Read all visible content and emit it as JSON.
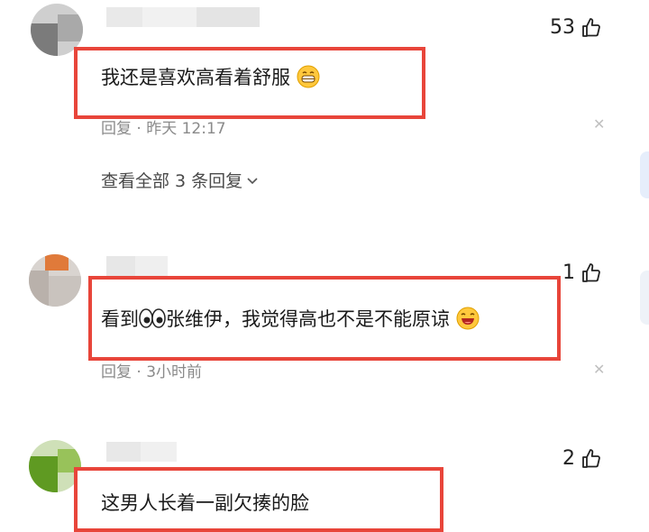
{
  "comments": [
    {
      "likes": "53",
      "text": "我还是喜欢高看着舒服",
      "emoji": "grin-emoji",
      "meta": "回复 · 昨天 12:17",
      "view_replies": "查看全部 3 条回复"
    },
    {
      "likes": "1",
      "text_before": "看到",
      "text_after": "张维伊，我觉得高也不是不能原谅",
      "emoji_inline": "eyes-emoji",
      "emoji": "laugh-emoji",
      "meta": "回复 · 3小时前"
    },
    {
      "likes": "2",
      "text": "这男人长着一副欠揍的脸"
    }
  ],
  "colors": {
    "highlight_border": "#e8453a",
    "meta_text": "#8a8a8a",
    "accent_tab": "#e6eefb"
  },
  "icons": {
    "like": "thumbs-up-icon",
    "close": "close-icon",
    "expand": "chevron-down-icon"
  }
}
